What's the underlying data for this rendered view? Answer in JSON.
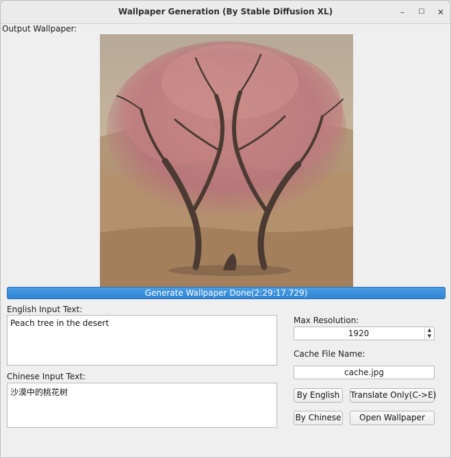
{
  "window": {
    "title": "Wallpaper Generation (By Stable Diffusion XL)",
    "minimize_symbol": "–",
    "maximize_symbol": "☐",
    "close_symbol": "✕"
  },
  "output": {
    "label": "Output Wallpaper:"
  },
  "progress": {
    "text": "Generate Wallpaper Done(2:29:17.729)",
    "value": 100
  },
  "english": {
    "label": "English Input Text:",
    "value": "Peach tree in the desert"
  },
  "chinese": {
    "label": "Chinese Input Text:",
    "value": "沙漠中的桃花树"
  },
  "resolution": {
    "label": "Max Resolution:",
    "value": "1920"
  },
  "cache": {
    "label": "Cache File Name:",
    "value": "cache.jpg"
  },
  "buttons": {
    "by_english": "By English",
    "translate_only": "Translate Only(C->E)",
    "by_chinese": "By Chinese",
    "open_wallpaper": "Open Wallpaper"
  }
}
